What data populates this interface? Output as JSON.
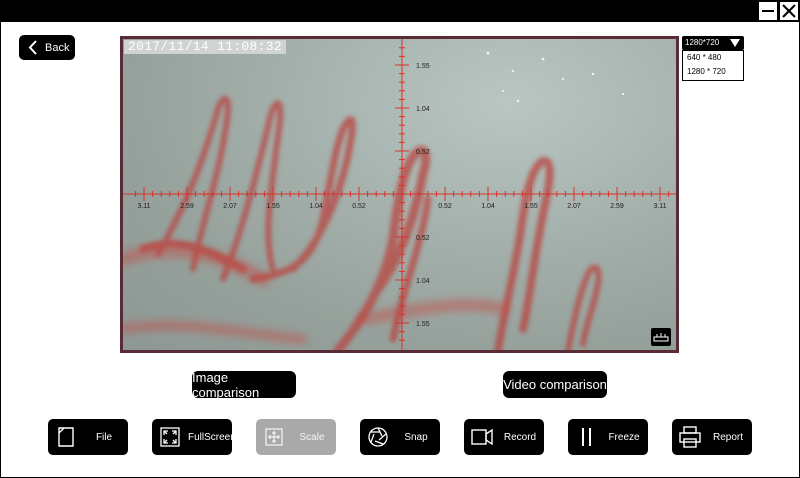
{
  "window": {
    "minimize_icon": "minimize-icon",
    "close_icon": "close-icon"
  },
  "nav": {
    "back_label": "Back",
    "back_icon": "chevron-left-icon"
  },
  "viewer": {
    "timestamp": "2017/11/14 11:08:32",
    "scale_x_labels_left": [
      "3.11",
      "2.59",
      "2.07",
      "1.55",
      "1.04",
      "0.52"
    ],
    "scale_x_labels_right": [
      "0.52",
      "1.04",
      "1.55",
      "2.07",
      "2.59",
      "3.11"
    ],
    "scale_y_labels_top": [
      "1.55",
      "1.04",
      "0.52"
    ],
    "scale_y_labels_bottom": [
      "0.52",
      "1.04",
      "1.55"
    ],
    "ruler_icon": "ruler-icon"
  },
  "resolution": {
    "selected": "1280*720",
    "options": [
      "640 * 480",
      "1280 * 720"
    ]
  },
  "compare": {
    "image_label": "Image comparison",
    "video_label": "Video comparison"
  },
  "toolbar": {
    "file_label": "File",
    "fullscreen_label": "FullScreen",
    "scale_label": "Scale",
    "snap_label": "Snap",
    "record_label": "Record",
    "freeze_label": "Freeze",
    "report_label": "Report"
  },
  "colors": {
    "scale_line": "#d8322c",
    "vessel": "#b8453f",
    "viewer_border": "#5a2a35",
    "disabled_button": "#a9a9a9"
  }
}
